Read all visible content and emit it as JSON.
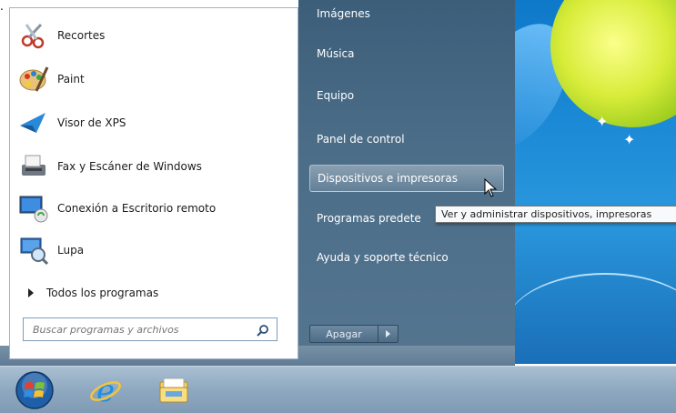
{
  "start_menu": {
    "programs": [
      {
        "label": "Recortes",
        "icon": "snipping-tool-icon"
      },
      {
        "label": "Paint",
        "icon": "paint-icon"
      },
      {
        "label": "Visor de XPS",
        "icon": "xps-viewer-icon"
      },
      {
        "label": "Fax y Escáner de Windows",
        "icon": "fax-scanner-icon"
      },
      {
        "label": "Conexión a Escritorio remoto",
        "icon": "remote-desktop-icon"
      },
      {
        "label": "Lupa",
        "icon": "magnifier-icon"
      }
    ],
    "all_programs_label": "Todos los programas",
    "search_placeholder": "Buscar programas y archivos",
    "right_items": [
      {
        "label": "Imágenes"
      },
      {
        "label": "Música"
      },
      {
        "label": "Equipo"
      },
      {
        "label": "Panel de control"
      },
      {
        "label": "Dispositivos e impresoras"
      },
      {
        "label": "Programas predete"
      },
      {
        "label": "Ayuda y soporte técnico"
      }
    ],
    "shutdown_label": "Apagar",
    "tooltip": "Ver y administrar dispositivos, impresoras"
  },
  "colors": {
    "right_pane": "#4b6d88",
    "highlight": "#ffffff",
    "taskbar": "#8ea8c0"
  },
  "taskbar": {
    "items": [
      "start-orb",
      "internet-explorer-icon",
      "windows-explorer-icon"
    ]
  }
}
